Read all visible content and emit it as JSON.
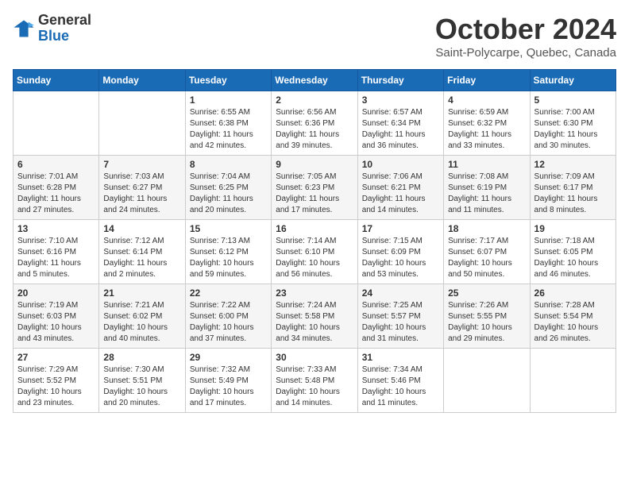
{
  "header": {
    "logo_line1": "General",
    "logo_line2": "Blue",
    "month": "October 2024",
    "location": "Saint-Polycarpe, Quebec, Canada"
  },
  "weekdays": [
    "Sunday",
    "Monday",
    "Tuesday",
    "Wednesday",
    "Thursday",
    "Friday",
    "Saturday"
  ],
  "weeks": [
    [
      {
        "day": "",
        "sunrise": "",
        "sunset": "",
        "daylight": ""
      },
      {
        "day": "",
        "sunrise": "",
        "sunset": "",
        "daylight": ""
      },
      {
        "day": "1",
        "sunrise": "Sunrise: 6:55 AM",
        "sunset": "Sunset: 6:38 PM",
        "daylight": "Daylight: 11 hours and 42 minutes."
      },
      {
        "day": "2",
        "sunrise": "Sunrise: 6:56 AM",
        "sunset": "Sunset: 6:36 PM",
        "daylight": "Daylight: 11 hours and 39 minutes."
      },
      {
        "day": "3",
        "sunrise": "Sunrise: 6:57 AM",
        "sunset": "Sunset: 6:34 PM",
        "daylight": "Daylight: 11 hours and 36 minutes."
      },
      {
        "day": "4",
        "sunrise": "Sunrise: 6:59 AM",
        "sunset": "Sunset: 6:32 PM",
        "daylight": "Daylight: 11 hours and 33 minutes."
      },
      {
        "day": "5",
        "sunrise": "Sunrise: 7:00 AM",
        "sunset": "Sunset: 6:30 PM",
        "daylight": "Daylight: 11 hours and 30 minutes."
      }
    ],
    [
      {
        "day": "6",
        "sunrise": "Sunrise: 7:01 AM",
        "sunset": "Sunset: 6:28 PM",
        "daylight": "Daylight: 11 hours and 27 minutes."
      },
      {
        "day": "7",
        "sunrise": "Sunrise: 7:03 AM",
        "sunset": "Sunset: 6:27 PM",
        "daylight": "Daylight: 11 hours and 24 minutes."
      },
      {
        "day": "8",
        "sunrise": "Sunrise: 7:04 AM",
        "sunset": "Sunset: 6:25 PM",
        "daylight": "Daylight: 11 hours and 20 minutes."
      },
      {
        "day": "9",
        "sunrise": "Sunrise: 7:05 AM",
        "sunset": "Sunset: 6:23 PM",
        "daylight": "Daylight: 11 hours and 17 minutes."
      },
      {
        "day": "10",
        "sunrise": "Sunrise: 7:06 AM",
        "sunset": "Sunset: 6:21 PM",
        "daylight": "Daylight: 11 hours and 14 minutes."
      },
      {
        "day": "11",
        "sunrise": "Sunrise: 7:08 AM",
        "sunset": "Sunset: 6:19 PM",
        "daylight": "Daylight: 11 hours and 11 minutes."
      },
      {
        "day": "12",
        "sunrise": "Sunrise: 7:09 AM",
        "sunset": "Sunset: 6:17 PM",
        "daylight": "Daylight: 11 hours and 8 minutes."
      }
    ],
    [
      {
        "day": "13",
        "sunrise": "Sunrise: 7:10 AM",
        "sunset": "Sunset: 6:16 PM",
        "daylight": "Daylight: 11 hours and 5 minutes."
      },
      {
        "day": "14",
        "sunrise": "Sunrise: 7:12 AM",
        "sunset": "Sunset: 6:14 PM",
        "daylight": "Daylight: 11 hours and 2 minutes."
      },
      {
        "day": "15",
        "sunrise": "Sunrise: 7:13 AM",
        "sunset": "Sunset: 6:12 PM",
        "daylight": "Daylight: 10 hours and 59 minutes."
      },
      {
        "day": "16",
        "sunrise": "Sunrise: 7:14 AM",
        "sunset": "Sunset: 6:10 PM",
        "daylight": "Daylight: 10 hours and 56 minutes."
      },
      {
        "day": "17",
        "sunrise": "Sunrise: 7:15 AM",
        "sunset": "Sunset: 6:09 PM",
        "daylight": "Daylight: 10 hours and 53 minutes."
      },
      {
        "day": "18",
        "sunrise": "Sunrise: 7:17 AM",
        "sunset": "Sunset: 6:07 PM",
        "daylight": "Daylight: 10 hours and 50 minutes."
      },
      {
        "day": "19",
        "sunrise": "Sunrise: 7:18 AM",
        "sunset": "Sunset: 6:05 PM",
        "daylight": "Daylight: 10 hours and 46 minutes."
      }
    ],
    [
      {
        "day": "20",
        "sunrise": "Sunrise: 7:19 AM",
        "sunset": "Sunset: 6:03 PM",
        "daylight": "Daylight: 10 hours and 43 minutes."
      },
      {
        "day": "21",
        "sunrise": "Sunrise: 7:21 AM",
        "sunset": "Sunset: 6:02 PM",
        "daylight": "Daylight: 10 hours and 40 minutes."
      },
      {
        "day": "22",
        "sunrise": "Sunrise: 7:22 AM",
        "sunset": "Sunset: 6:00 PM",
        "daylight": "Daylight: 10 hours and 37 minutes."
      },
      {
        "day": "23",
        "sunrise": "Sunrise: 7:24 AM",
        "sunset": "Sunset: 5:58 PM",
        "daylight": "Daylight: 10 hours and 34 minutes."
      },
      {
        "day": "24",
        "sunrise": "Sunrise: 7:25 AM",
        "sunset": "Sunset: 5:57 PM",
        "daylight": "Daylight: 10 hours and 31 minutes."
      },
      {
        "day": "25",
        "sunrise": "Sunrise: 7:26 AM",
        "sunset": "Sunset: 5:55 PM",
        "daylight": "Daylight: 10 hours and 29 minutes."
      },
      {
        "day": "26",
        "sunrise": "Sunrise: 7:28 AM",
        "sunset": "Sunset: 5:54 PM",
        "daylight": "Daylight: 10 hours and 26 minutes."
      }
    ],
    [
      {
        "day": "27",
        "sunrise": "Sunrise: 7:29 AM",
        "sunset": "Sunset: 5:52 PM",
        "daylight": "Daylight: 10 hours and 23 minutes."
      },
      {
        "day": "28",
        "sunrise": "Sunrise: 7:30 AM",
        "sunset": "Sunset: 5:51 PM",
        "daylight": "Daylight: 10 hours and 20 minutes."
      },
      {
        "day": "29",
        "sunrise": "Sunrise: 7:32 AM",
        "sunset": "Sunset: 5:49 PM",
        "daylight": "Daylight: 10 hours and 17 minutes."
      },
      {
        "day": "30",
        "sunrise": "Sunrise: 7:33 AM",
        "sunset": "Sunset: 5:48 PM",
        "daylight": "Daylight: 10 hours and 14 minutes."
      },
      {
        "day": "31",
        "sunrise": "Sunrise: 7:34 AM",
        "sunset": "Sunset: 5:46 PM",
        "daylight": "Daylight: 10 hours and 11 minutes."
      },
      {
        "day": "",
        "sunrise": "",
        "sunset": "",
        "daylight": ""
      },
      {
        "day": "",
        "sunrise": "",
        "sunset": "",
        "daylight": ""
      }
    ]
  ]
}
